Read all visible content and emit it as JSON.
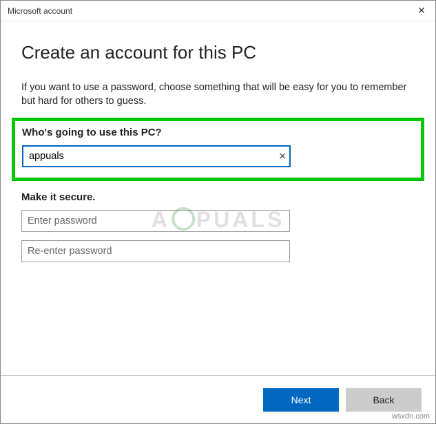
{
  "window": {
    "title": "Microsoft account"
  },
  "page": {
    "heading": "Create an account for this PC",
    "description": "If you want to use a password, choose something that will be easy for you to remember but hard for others to guess."
  },
  "username": {
    "label": "Who's going to use this PC?",
    "value": "appuals",
    "clear_symbol": "✕"
  },
  "password": {
    "label": "Make it secure.",
    "placeholder1": "Enter password",
    "placeholder2": "Re-enter password"
  },
  "buttons": {
    "next": "Next",
    "back": "Back"
  },
  "watermark": {
    "left": "A",
    "right": "PUALS"
  },
  "attribution": "wsxdn.com",
  "close_symbol": "✕"
}
